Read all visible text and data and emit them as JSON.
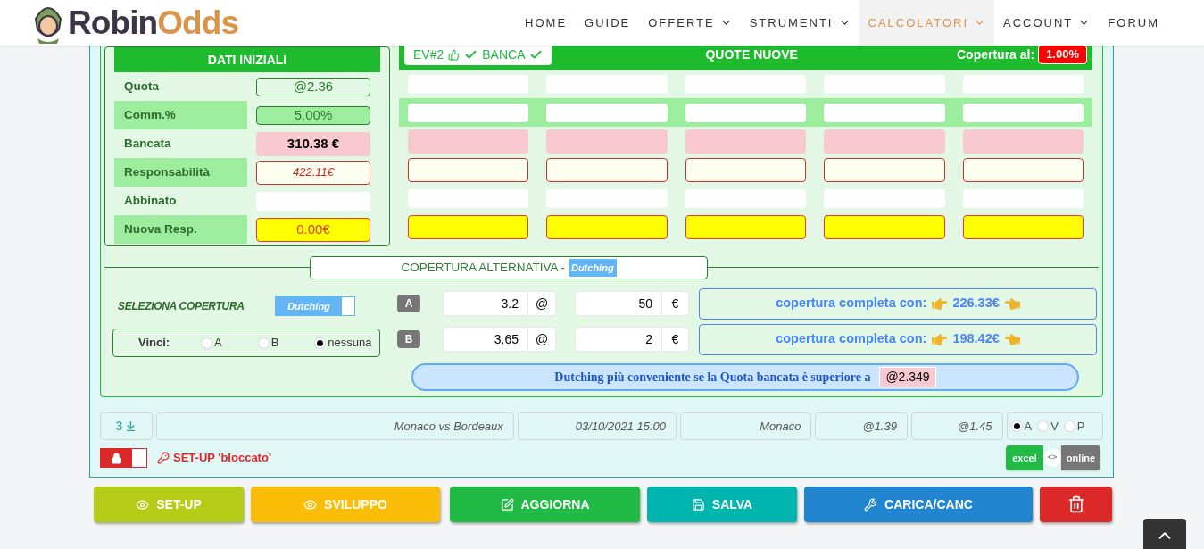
{
  "header": {
    "logo": {
      "first": "Robin",
      "second": "Odds"
    },
    "nav": [
      {
        "label": "HOME",
        "dropdown": false,
        "selected": false
      },
      {
        "label": "GUIDE",
        "dropdown": false,
        "selected": false
      },
      {
        "label": "OFFERTE",
        "dropdown": true,
        "selected": false
      },
      {
        "label": "STRUMENTI",
        "dropdown": true,
        "selected": false
      },
      {
        "label": "CALCOLATORI",
        "dropdown": true,
        "selected": true
      },
      {
        "label": "ACCOUNT",
        "dropdown": true,
        "selected": false
      },
      {
        "label": "FORUM",
        "dropdown": false,
        "selected": false
      }
    ]
  },
  "dati_iniziali": {
    "title": "DATI INIZIALI",
    "rows": [
      {
        "label": "Quota",
        "value": "@2.36",
        "kind": "quota"
      },
      {
        "label": "Comm.%",
        "value": "5.00%",
        "kind": "comm"
      },
      {
        "label": "Bancata",
        "value": "310.38 €",
        "kind": "bancata"
      },
      {
        "label": "Responsabilità",
        "value": "422.11€",
        "kind": "resp"
      },
      {
        "label": "Abbinato",
        "kind": "abbinato"
      },
      {
        "label": "Nuova Resp.",
        "value": "0.00€",
        "kind": "nuova"
      }
    ]
  },
  "quote_nuove": {
    "event_tag": "EV#2",
    "bet_tag": "BANCA",
    "title": "QUOTE NUOVE",
    "coverage_label": "Copertura al:",
    "coverage_value": "1.00%"
  },
  "copertura_alternativa": {
    "title": "COPERTURA ALTERNATIVA -",
    "tag": "Dutching",
    "select_label": "SELEZIONA COPERTURA",
    "toggle": {
      "label": "Dutching",
      "on": true
    },
    "vinci": {
      "label": "Vinci:",
      "options": [
        {
          "label": "A",
          "selected": false
        },
        {
          "label": "B",
          "selected": false
        },
        {
          "label": "nessuna",
          "selected": true
        }
      ]
    },
    "bets": [
      {
        "letter": "A",
        "quota": "3.2",
        "quota_unit": "@",
        "stake": "50",
        "stake_unit": "€",
        "result_label": "copertura completa con:",
        "result": "226.33€"
      },
      {
        "letter": "B",
        "quota": "3.65",
        "quota_unit": "@",
        "stake": "2",
        "stake_unit": "€",
        "result_label": "copertura completa con:",
        "result": "198.42€"
      }
    ],
    "note": {
      "text": "Dutching più conveniente se la Quota bancata è superiore a",
      "value": "@2.349"
    }
  },
  "event": {
    "count": "3",
    "cells": [
      "Monaco vs Bordeaux",
      "03/10/2021 15:00",
      "Monaco",
      "@1.39",
      "@1.45"
    ],
    "options": [
      {
        "label": "A",
        "selected": true
      },
      {
        "label": "V",
        "selected": false
      },
      {
        "label": "P",
        "selected": false
      }
    ]
  },
  "setup": {
    "locked": true,
    "text": "SET-UP 'bloccato'"
  },
  "mode_switch": {
    "left": "excel",
    "middle": "<>",
    "right": "online"
  },
  "buttons": [
    {
      "label": "SET-UP",
      "kind": "setup"
    },
    {
      "label": "SVILUPPO",
      "kind": "sviluppo"
    },
    {
      "label": "AGGIORNA",
      "kind": "aggiorna"
    },
    {
      "label": "SALVA",
      "kind": "salva"
    },
    {
      "label": "CARICA/CANC",
      "kind": "carica"
    },
    {
      "kind": "delete"
    }
  ]
}
